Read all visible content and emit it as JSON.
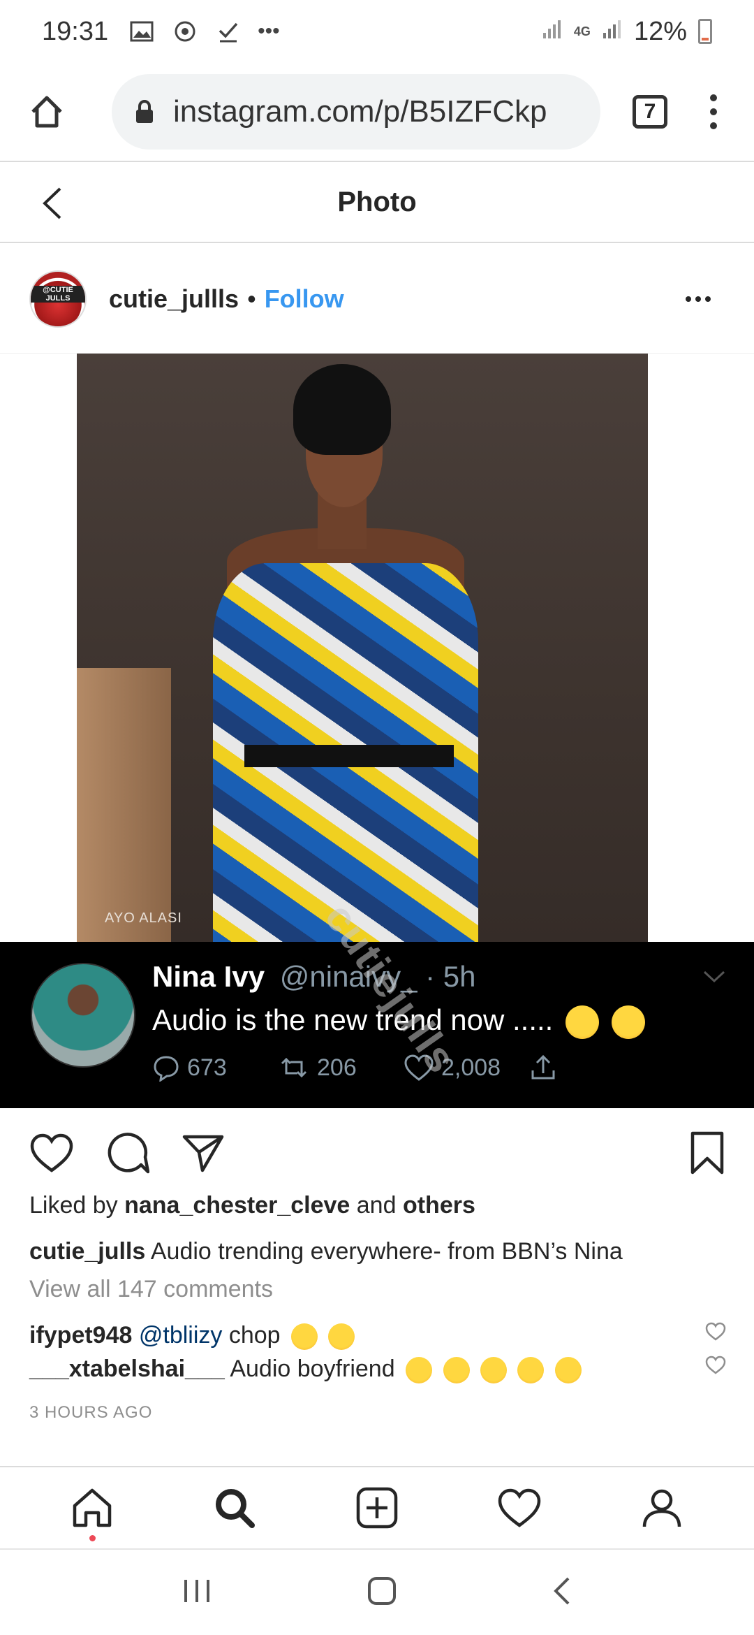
{
  "status_bar": {
    "time": "19:31",
    "overflow": "•••",
    "network": "4G",
    "battery": "12%"
  },
  "browser": {
    "url": "instagram.com/p/B5IZFCkp",
    "tab_count": "7"
  },
  "header": {
    "title": "Photo"
  },
  "post": {
    "username": "cutie_jullls",
    "separator": "•",
    "follow_label": "Follow",
    "avatar_text": "@CUTIE JULLS",
    "photo_credit": "AYO ALASI"
  },
  "tweet": {
    "name": "Nina Ivy",
    "handle": "@ninaivy_ · 5h",
    "text": "Audio is the new trend now .....",
    "replies": "673",
    "retweets": "206",
    "likes": "2,008",
    "watermark": "cutiejulls"
  },
  "engagement": {
    "liked_prefix": "Liked by",
    "liked_user": "nana_chester_cleve",
    "liked_and": "and",
    "liked_others": "others",
    "caption_user": "cutie_julls",
    "caption_text": "Audio trending everywhere- from BBN’s Nina",
    "view_comments": "View all 147 comments"
  },
  "comments": [
    {
      "user": "ifypet948",
      "mention": "@tbliizy",
      "text": "chop"
    },
    {
      "user": "___xtabelshai___",
      "text": "Audio boyfriend"
    }
  ],
  "timestamp": "3 HOURS AGO",
  "colors": {
    "follow_blue": "#3897f0",
    "tweet_bg": "#000000",
    "notification_dot": "#ed4956"
  }
}
